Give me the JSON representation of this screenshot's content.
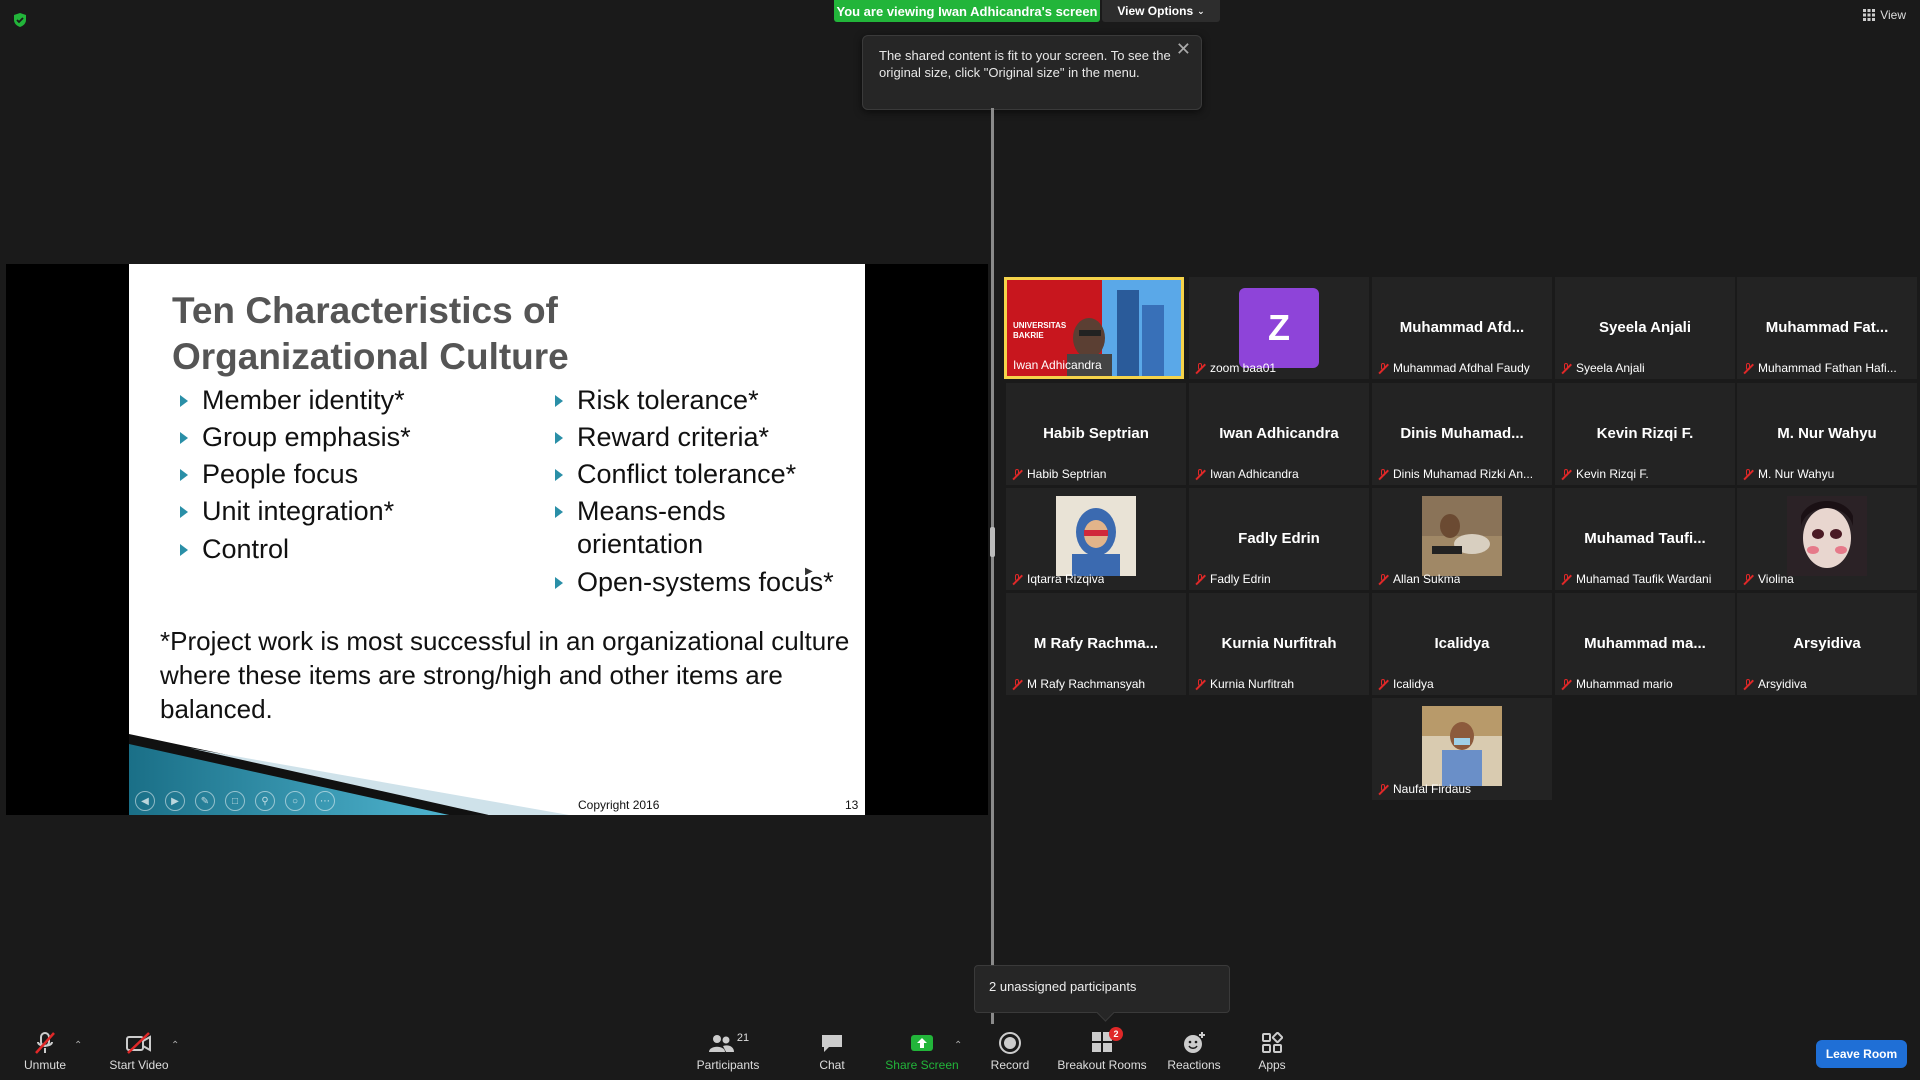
{
  "top_bar": {
    "viewing_banner": "You are viewing Iwan Adhicandra's screen",
    "view_options_label": "View Options",
    "view_label": "View"
  },
  "tooltip": {
    "text": "The shared content is fit to your screen. To see the original size, click \"Original size\" in the menu."
  },
  "slide": {
    "title_line1": "Ten Characteristics of",
    "title_line2": "Organizational Culture",
    "left_items": [
      "Member identity*",
      "Group emphasis*",
      "People focus",
      "Unit integration*",
      "Control"
    ],
    "right_items": [
      "Risk tolerance*",
      "Reward criteria*",
      "Conflict tolerance*",
      "Means-ends",
      "orientation",
      "Open-systems focus*"
    ],
    "note": "*Project work is most successful in an organizational culture where these items are strong/high and other items are balanced.",
    "copyright": "Copyright 2016",
    "page_number": "13",
    "accent_color": "#2a8fa7"
  },
  "gallery": [
    {
      "name": "Iwan Adhicandra",
      "label": "Iwan Adhicandra",
      "type": "video",
      "active": true
    },
    {
      "name": "zoom baa01",
      "label": "zoom baa01",
      "type": "avatar-letter",
      "letter": "Z"
    },
    {
      "name": "Muhammad Afdhal Faudy",
      "label": "Muhammad  Afd..."
    },
    {
      "name": "Syeela Anjali",
      "label": "Syeela Anjali"
    },
    {
      "name": "Muhammad Fathan Hafi...",
      "label": "Muhammad  Fat..."
    },
    {
      "name": "Habib Septrian",
      "label": "Habib Septrian"
    },
    {
      "name": "Iwan Adhicandra",
      "label": "Iwan Adhicandra"
    },
    {
      "name": "Dinis Muhamad Rizki An...",
      "label": "Dinis  Muhamad..."
    },
    {
      "name": "Kevin Rizqi F.",
      "label": "Kevin Rizqi F."
    },
    {
      "name": "M. Nur Wahyu",
      "label": "M. Nur Wahyu"
    },
    {
      "name": "Iqtarra Rizqiva",
      "label": "",
      "type": "photo"
    },
    {
      "name": "Fadly Edrin",
      "label": "Fadly Edrin"
    },
    {
      "name": "Allan Sukma",
      "label": "",
      "type": "photo"
    },
    {
      "name": "Muhamad Taufik Wardani",
      "label": "Muhamad  Taufi..."
    },
    {
      "name": "Violina",
      "label": "",
      "type": "photo"
    },
    {
      "name": "M Rafy Rachmansyah",
      "label": "M Rafy Rachma..."
    },
    {
      "name": "Kurnia Nurfitrah",
      "label": "Kurnia Nurfitrah"
    },
    {
      "name": "Icalidya",
      "label": "Icalidya"
    },
    {
      "name": "Muhammad mario",
      "label": "Muhammad  ma..."
    },
    {
      "name": "Arsyidiva",
      "label": "Arsyidiva"
    },
    {
      "name": "Naufal Firdaus",
      "label": "",
      "type": "photo"
    }
  ],
  "unassigned_popup": "2 unassigned participants",
  "toolbar": {
    "unmute": "Unmute",
    "start_video": "Start Video",
    "participants": "Participants",
    "participants_count": "21",
    "chat": "Chat",
    "share_screen": "Share Screen",
    "record": "Record",
    "breakout_rooms": "Breakout Rooms",
    "breakout_badge": "2",
    "reactions": "Reactions",
    "apps": "Apps",
    "leave_room": "Leave Room"
  },
  "colors": {
    "share_green": "#22b53a",
    "leave_blue": "#1f6fd6",
    "muted_red": "#e02828",
    "active_speaker": "#f5d34a"
  }
}
